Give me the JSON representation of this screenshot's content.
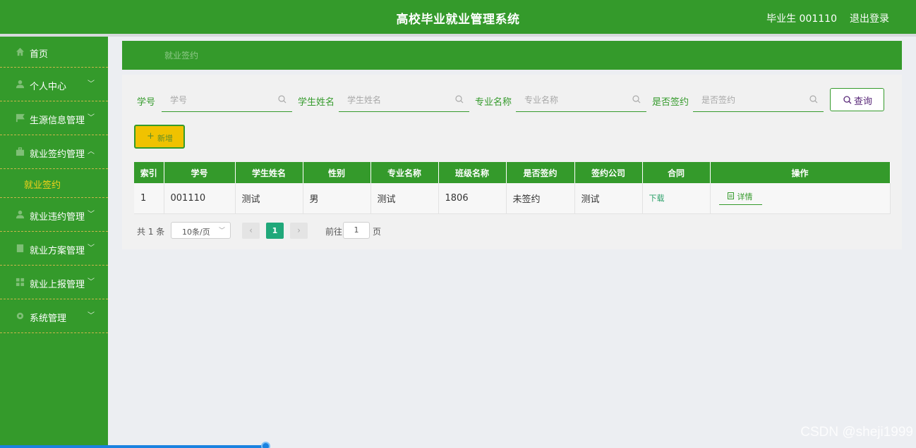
{
  "header": {
    "title": "高校毕业就业管理系统",
    "user": "毕业生 001110",
    "logout": "退出登录"
  },
  "sidebar": {
    "items": [
      {
        "label": "首页",
        "icon": "home-icon"
      },
      {
        "label": "个人中心",
        "icon": "user-icon"
      },
      {
        "label": "生源信息管理",
        "icon": "flag-icon"
      },
      {
        "label": "就业签约管理",
        "icon": "briefcase-icon",
        "expanded": true,
        "children": [
          {
            "label": "就业签约"
          }
        ]
      },
      {
        "label": "就业违约管理",
        "icon": "user-icon"
      },
      {
        "label": "就业方案管理",
        "icon": "doc-icon"
      },
      {
        "label": "就业上报管理",
        "icon": "grid-icon"
      },
      {
        "label": "系统管理",
        "icon": "gear-icon"
      }
    ]
  },
  "breadcrumb": "就业签约",
  "search": {
    "fields": [
      {
        "label": "学号",
        "placeholder": "学号"
      },
      {
        "label": "学生姓名",
        "placeholder": "学生姓名"
      },
      {
        "label": "专业名称",
        "placeholder": "专业名称"
      },
      {
        "label": "是否签约",
        "placeholder": "是否签约"
      }
    ],
    "query_label": "查询"
  },
  "actions": {
    "add_label": "新增"
  },
  "table": {
    "headers": [
      "索引",
      "学号",
      "学生姓名",
      "性别",
      "专业名称",
      "班级名称",
      "是否签约",
      "签约公司",
      "合同",
      "操作"
    ],
    "rows": [
      {
        "index": "1",
        "id": "001110",
        "name": "测试",
        "gender": "男",
        "major": "测试",
        "class": "1806",
        "signed": "未签约",
        "company": "测试",
        "contract": "下载",
        "action": "详情"
      }
    ]
  },
  "pager": {
    "total": "共 1 条",
    "page_size": "10条/页",
    "current_page": "1",
    "goto_label": "前往",
    "goto_value": "1",
    "page_unit": "页"
  },
  "watermark": "CSDN @sheji1999",
  "colors": {
    "primary": "#349a2b",
    "accent_yellow": "#f0c200",
    "submenu_text": "#f2d21b",
    "pager_active": "#20a87a"
  }
}
